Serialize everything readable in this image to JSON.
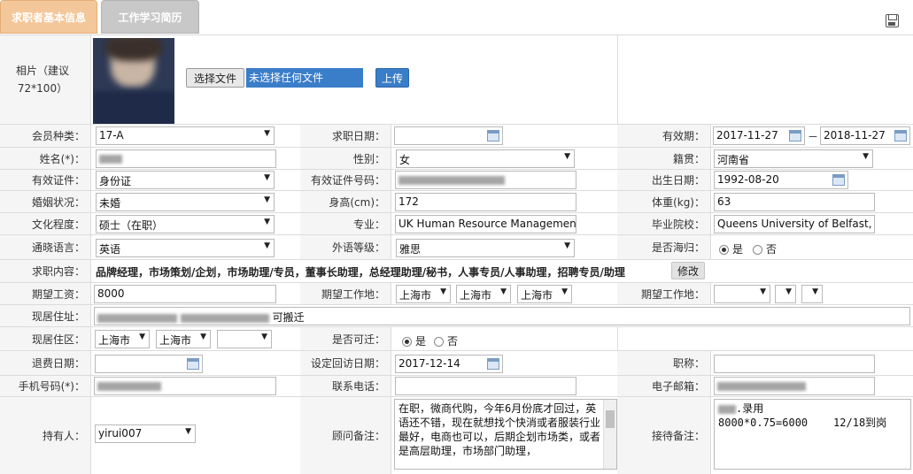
{
  "tabs": [
    "求职者基本信息",
    "工作学习简历"
  ],
  "save_icon": "save-icon",
  "photo": {
    "label": "相片（建议72*100）",
    "choose_btn": "选择文件",
    "no_file": "未选择任何文件",
    "upload_btn": "上传"
  },
  "row1": {
    "member_label": "会员种类：",
    "member_value": "17-A",
    "jobdate_label": "求职日期：",
    "jobdate_value": "",
    "valid_label": "有效期：",
    "valid_from": "2017-11-27",
    "valid_sep": "－",
    "valid_to": "2018-11-27"
  },
  "row2": {
    "name_label": "姓名(*)：",
    "gender_label": "性别：",
    "gender_value": "女",
    "origin_label": "籍贯：",
    "origin_value": "河南省"
  },
  "row3": {
    "idtype_label": "有效证件：",
    "idtype_value": "身份证",
    "idno_label": "有效证件号码：",
    "birth_label": "出生日期：",
    "birth_value": "1992-08-20"
  },
  "row4": {
    "marriage_label": "婚姻状况：",
    "marriage_value": "未婚",
    "height_label": "身高(cm)：",
    "height_value": "172",
    "weight_label": "体重(kg)：",
    "weight_value": "63"
  },
  "row5": {
    "edu_label": "文化程度：",
    "edu_value": "硕士（在职）",
    "major_label": "专业：",
    "major_value": "UK  Human Resource Management",
    "school_label": "毕业院校：",
    "school_value": "Queens University of Belfast,"
  },
  "row6": {
    "lang_label": "通晓语言：",
    "lang_value": "英语",
    "level_label": "外语等级：",
    "level_value": "雅思",
    "abroad_label": "是否海归：",
    "yes": "是",
    "no": "否"
  },
  "row7": {
    "content_label": "求职内容：",
    "content_value": "品牌经理，市场策划/企划，市场助理/专员，董事长助理，总经理助理/秘书，人事专员/人事助理，招聘专员/助理",
    "modify_btn": "修改"
  },
  "row8": {
    "salary_label": "期望工资：",
    "salary_value": "8000",
    "place_label": "期望工作地：",
    "place1": "上海市",
    "place2": "上海市",
    "place3": "上海市",
    "place2_label": "期望工作地："
  },
  "row9": {
    "addr_label": "现居住址：",
    "addr_suffix": "可搬迁"
  },
  "row10": {
    "area_label": "现居住区：",
    "area1": "上海市",
    "area2": "上海市",
    "move_label": "是否可迁：",
    "yes": "是",
    "no": "否"
  },
  "row11": {
    "refund_label": "退费日期：",
    "revisit_label": "设定回访日期：",
    "revisit_value": "2017-12-14",
    "title_label": "职称："
  },
  "row12": {
    "mobile_label": "手机号码(*)：",
    "phone_label": "联系电话：",
    "email_label": "电子邮箱："
  },
  "row13": {
    "owner_label": "持有人：",
    "owner_value": "yirui007",
    "advisor_label": "顾问备注：",
    "advisor_text": "在职，微商代购，今年6月份底才回过，英语还不错，现在就想找个快消或者服装行业最好，电商也可以，后期企划市场类，或者是高层助理，市场部门助理，",
    "reception_label": "接待备注：",
    "reception_line1": ".录用",
    "reception_line2": "8000*0.75=6000    12/18到岗"
  }
}
